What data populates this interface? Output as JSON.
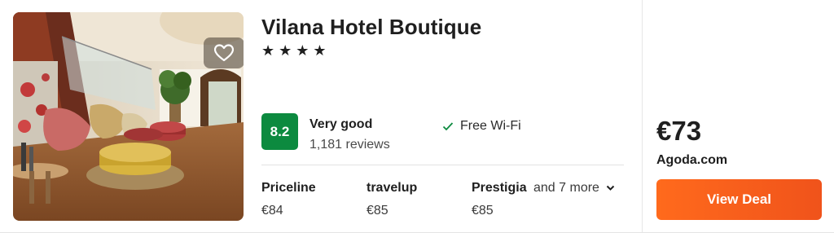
{
  "hotel": {
    "name": "Vilana Hotel Boutique",
    "stars": "★★★★",
    "rating": {
      "score": "8.2",
      "label": "Very good",
      "reviews": "1,181 reviews",
      "color": "#0c8a3f"
    },
    "amenity": "Free Wi-Fi"
  },
  "providers": [
    {
      "name": "Priceline",
      "price": "€84"
    },
    {
      "name": "travelup",
      "price": "€85"
    },
    {
      "name": "Prestigia",
      "price": "€85"
    }
  ],
  "more_providers": "and 7 more",
  "best_offer": {
    "price": "€73",
    "vendor": "Agoda.com",
    "button_label": "View Deal",
    "button_color": "#ff6a1c"
  },
  "icons": {
    "favorite": "heart-icon",
    "amenity": "check-icon",
    "more": "chevron-down-icon"
  }
}
